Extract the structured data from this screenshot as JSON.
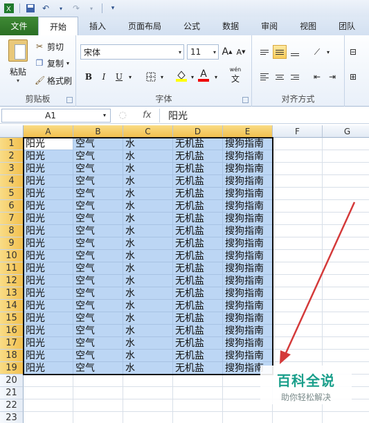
{
  "qat": {
    "save_icon": "save-icon",
    "undo_icon": "undo-icon",
    "redo_icon": "redo-icon",
    "customize_icon": "customize-icon"
  },
  "tabs": [
    "文件",
    "开始",
    "插入",
    "页面布局",
    "公式",
    "数据",
    "审阅",
    "视图",
    "团队"
  ],
  "ribbon": {
    "clipboard": {
      "paste": "粘贴",
      "cut": "剪切",
      "copy": "复制",
      "format_painter": "格式刷",
      "label": "剪贴板"
    },
    "font": {
      "name": "宋体",
      "size": "11",
      "grow": "A",
      "shrink": "A",
      "bold": "B",
      "italic": "I",
      "underline": "U",
      "font_color": "A",
      "phonetic": "wén",
      "label": "字体"
    },
    "alignment": {
      "label": "对齐方式"
    }
  },
  "formula_bar": {
    "name_box": "A1",
    "fx": "fx",
    "value": "阳光"
  },
  "grid": {
    "columns": [
      "A",
      "B",
      "C",
      "D",
      "E",
      "F",
      "G"
    ],
    "rows": [
      "1",
      "2",
      "3",
      "4",
      "5",
      "6",
      "7",
      "8",
      "9",
      "10",
      "11",
      "12",
      "13",
      "14",
      "15",
      "16",
      "17",
      "18",
      "19",
      "20",
      "21",
      "22",
      "23"
    ],
    "row_values": [
      "阳光",
      "空气",
      "水",
      "无机盐",
      "搜狗指南"
    ],
    "filled_rows": 19
  },
  "watermark": {
    "title": "百科全说",
    "subtitle": "助你轻松解决"
  },
  "colors": {
    "accent": "#2a6f24",
    "selection": "#bcd6f4",
    "header_selected": "#f2c04f",
    "arrow": "#d43a3a"
  }
}
